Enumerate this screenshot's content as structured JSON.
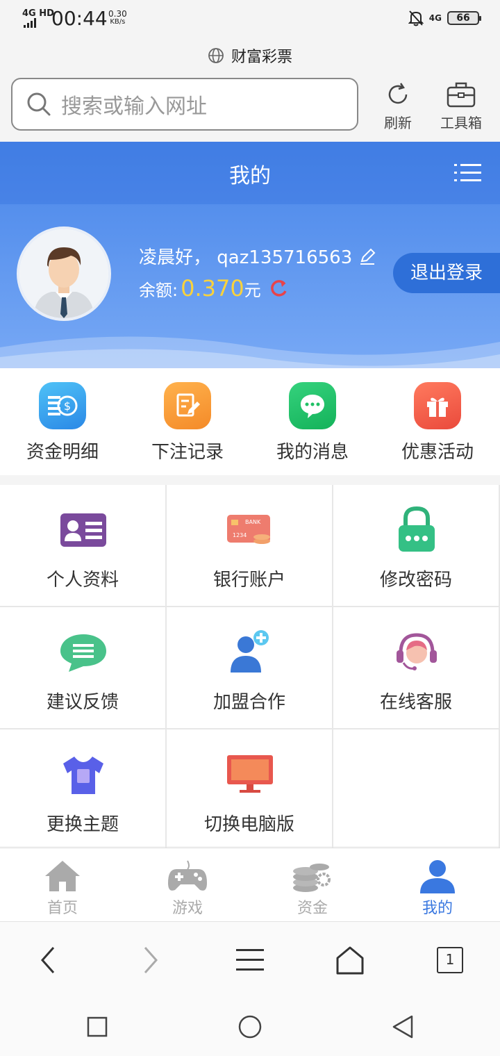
{
  "status_bar": {
    "network": "4G HD",
    "time": "00:44",
    "speed_value": "0.30",
    "speed_unit": "KB/s",
    "signal_right": "4G",
    "battery": "66"
  },
  "browser": {
    "site_title": "财富彩票",
    "search_placeholder": "搜索或输入网址",
    "refresh_label": "刷新",
    "toolbox_label": "工具箱"
  },
  "profile": {
    "page_title": "我的",
    "greeting": "凌晨好，",
    "username": "qaz135716563",
    "balance_label": "余额:",
    "balance_amount": "0.370",
    "balance_unit": "元",
    "logout_label": "退出登录"
  },
  "quick_actions": [
    {
      "label": "资金明细",
      "icon": "money-icon",
      "color": "#3aa0ee"
    },
    {
      "label": "下注记录",
      "icon": "note-edit-icon",
      "color": "#f79a3a"
    },
    {
      "label": "我的消息",
      "icon": "chat-icon",
      "color": "#22c36a"
    },
    {
      "label": "优惠活动",
      "icon": "gift-icon",
      "color": "#f0604e"
    }
  ],
  "grid_items": [
    {
      "label": "个人资料",
      "icon": "id-card-icon"
    },
    {
      "label": "银行账户",
      "icon": "bank-card-icon"
    },
    {
      "label": "修改密码",
      "icon": "lock-icon"
    },
    {
      "label": "建议反馈",
      "icon": "feedback-bubble-icon"
    },
    {
      "label": "加盟合作",
      "icon": "add-user-icon"
    },
    {
      "label": "在线客服",
      "icon": "headset-icon"
    },
    {
      "label": "更换主题",
      "icon": "tshirt-icon"
    },
    {
      "label": "切换电脑版",
      "icon": "monitor-icon"
    }
  ],
  "tabs": [
    {
      "label": "首页",
      "icon": "home-icon",
      "active": false
    },
    {
      "label": "游戏",
      "icon": "gamepad-icon",
      "active": false
    },
    {
      "label": "资金",
      "icon": "coins-icon",
      "active": false
    },
    {
      "label": "我的",
      "icon": "user-icon",
      "active": true
    }
  ],
  "browser_nav": {
    "tab_count": "1"
  },
  "colors": {
    "primary": "#3a78e0",
    "balance": "#f9d23c",
    "refresh_icon": "#e8434a"
  }
}
